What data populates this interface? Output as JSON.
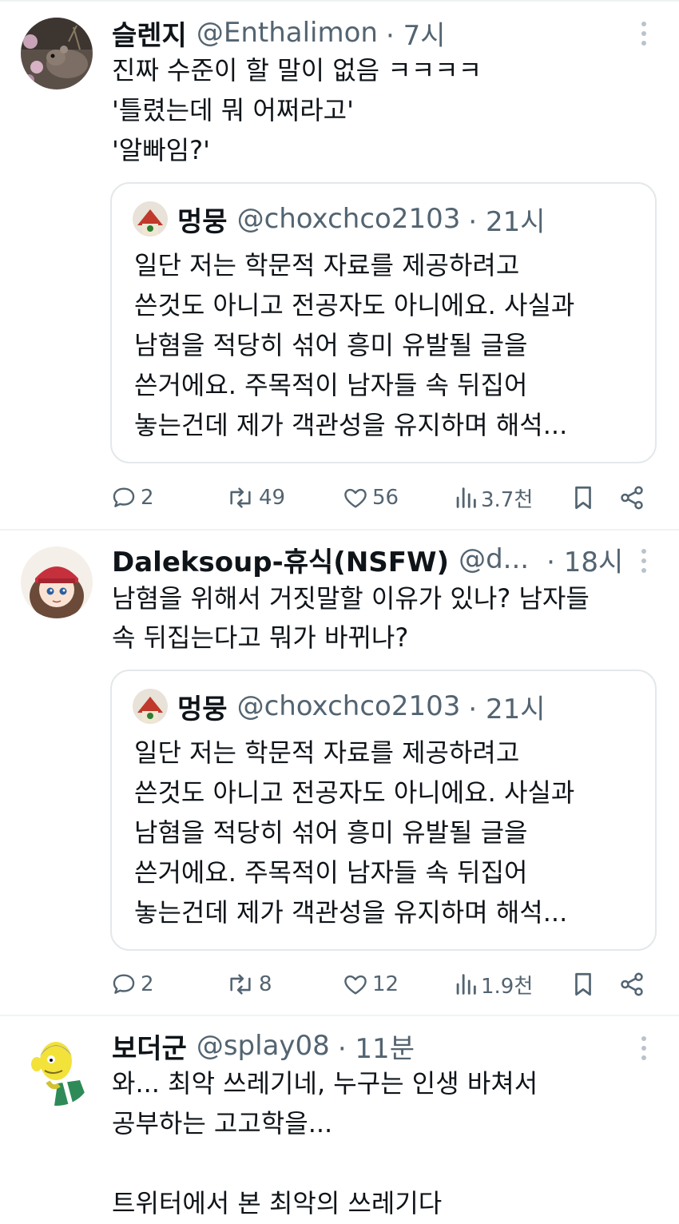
{
  "tweets": [
    {
      "name": "슬렌지",
      "handle": "@Enthalimon",
      "time": "· 7시",
      "lines": [
        "진짜 수준이 할 말이 없음 ㅋㅋㅋㅋ",
        "'틀렸는데 뭐 어쩌라고'",
        "'알빠임?'"
      ],
      "quote": {
        "name": "멍뭉",
        "handle": "@choxchco2103",
        "time": "· 21시",
        "lines": [
          "일단 저는 학문적 자료를 제공하려고",
          "쓴것도 아니고 전공자도 아니에요. 사실과",
          "남혐을 적당히 섞어 흥미 유발될 글을",
          "쓴거에요. 주목적이 남자들 속 뒤집어",
          "놓는건데 제가 객관성을 유지하며 해석..."
        ]
      },
      "stats": {
        "replies": "2",
        "retweets": "49",
        "likes": "56",
        "views": "3.7천"
      }
    },
    {
      "name": "Daleksoup-휴식(NSFW)",
      "handle": "@d...",
      "time": "· 18시",
      "lines": [
        "남혐을 위해서 거짓말할 이유가 있나? 남자들",
        "속 뒤집는다고 뭐가 바뀌나?"
      ],
      "quote": {
        "name": "멍뭉",
        "handle": "@choxchco2103",
        "time": "· 21시",
        "lines": [
          "일단 저는 학문적 자료를 제공하려고",
          "쓴것도 아니고 전공자도 아니에요. 사실과",
          "남혐을 적당히 섞어 흥미 유발될 글을",
          "쓴거에요. 주목적이 남자들 속 뒤집어",
          "놓는건데 제가 객관성을 유지하며 해석..."
        ]
      },
      "stats": {
        "replies": "2",
        "retweets": "8",
        "likes": "12",
        "views": "1.9천"
      }
    },
    {
      "name": "보더군",
      "handle": "@splay08",
      "time": "· 11분",
      "lines": [
        "와... 최악 쓰레기네, 누구는 인생 바쳐서",
        "공부하는 고고학을...",
        "",
        "트위터에서 본 최악의 쓰레기다"
      ]
    }
  ],
  "icons": {
    "reply": "reply-bubble-icon",
    "retweet": "retweet-icon",
    "like": "heart-icon",
    "views": "views-bar-chart-icon",
    "bookmark": "bookmark-icon",
    "share": "share-icon",
    "more": "more-vertical-icon"
  },
  "colors": {
    "text": "#0f1419",
    "secondary": "#536471",
    "border": "#e3e8eb"
  }
}
